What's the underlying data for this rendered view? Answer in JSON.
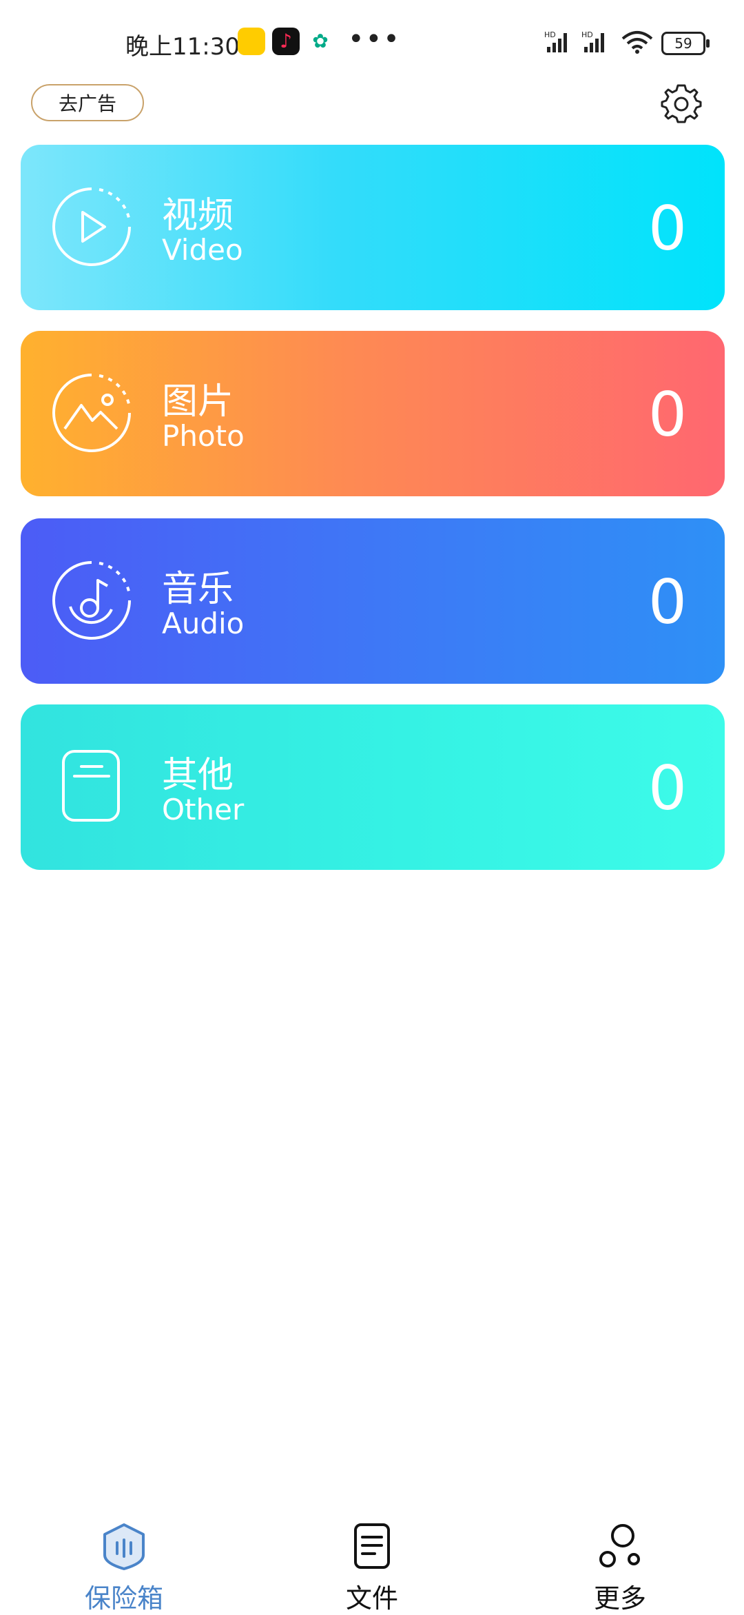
{
  "status_bar": {
    "time": "晚上11:30",
    "battery": "59",
    "icons": [
      "notes-app-icon",
      "tiktok-icon",
      "wechat-icon",
      "more-notifications-icon",
      "signal-hd-icon",
      "signal-hd-icon",
      "wifi-icon",
      "battery-icon"
    ]
  },
  "header": {
    "remove_ads_label": "去广告",
    "settings_icon": "gear-icon"
  },
  "categories": [
    {
      "zh": "视频",
      "en": "Video",
      "count": "0",
      "icon": "play-circle-icon",
      "colors": [
        "#7de6fb",
        "#00e3fb"
      ]
    },
    {
      "zh": "图片",
      "en": "Photo",
      "count": "0",
      "icon": "mountain-photo-icon",
      "colors": [
        "#ffb12e",
        "#ff6770"
      ]
    },
    {
      "zh": "音乐",
      "en": "Audio",
      "count": "0",
      "icon": "music-disc-icon",
      "colors": [
        "#4c5cf6",
        "#2e90f6"
      ]
    },
    {
      "zh": "其他",
      "en": "Other",
      "count": "0",
      "icon": "document-icon",
      "colors": [
        "#32e3df",
        "#3dfbe9"
      ]
    }
  ],
  "tabs": [
    {
      "label": "保险箱",
      "icon": "shield-vault-icon",
      "active": true,
      "color": "#4a84c9"
    },
    {
      "label": "文件",
      "icon": "file-list-icon",
      "active": false
    },
    {
      "label": "更多",
      "icon": "more-circles-icon",
      "active": false
    }
  ]
}
